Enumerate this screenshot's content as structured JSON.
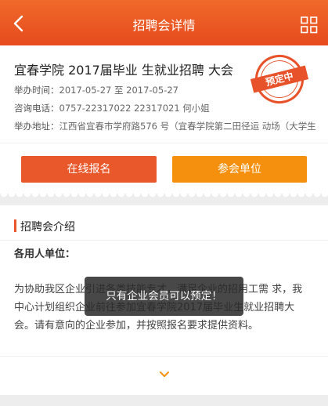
{
  "header": {
    "title": "招聘会详情",
    "back_icon": "chevron-left-icon",
    "menu_icon": "grid-icon"
  },
  "fair": {
    "title": "宜春学院 2017届毕业 生就业招聘 大会",
    "time_label": "举办时间：",
    "time_value": "2017-05-27 至 2017-05-27",
    "phone_label": "咨询电话：",
    "phone_value": "0757-22317022 22317021 何小姐",
    "address_label": "举办地址：",
    "address_value": "江西省宜春市学府路576 号（宜春学院第二田径运 动场（大学生",
    "stamp_text": "预定中"
  },
  "actions": {
    "apply_label": "在线报名",
    "units_label": "参会单位"
  },
  "intro": {
    "section_title": "招聘会介绍",
    "units_heading": "各用人单位：",
    "body": "为协助我区企业引进各类技能专才，满足企业的招用工需 求，我中心计划组织企业前往参加宜春学院2017届毕业生就业招聘大会。请有意向的企业参加，并按照报名要求提供资料。",
    "expand_icon": "chevron-down-icon"
  },
  "toast": {
    "message": "只有企业会员可以预定！"
  },
  "colors": {
    "brand_orange": "#e8582a",
    "accent_yellow": "#f4900e"
  }
}
